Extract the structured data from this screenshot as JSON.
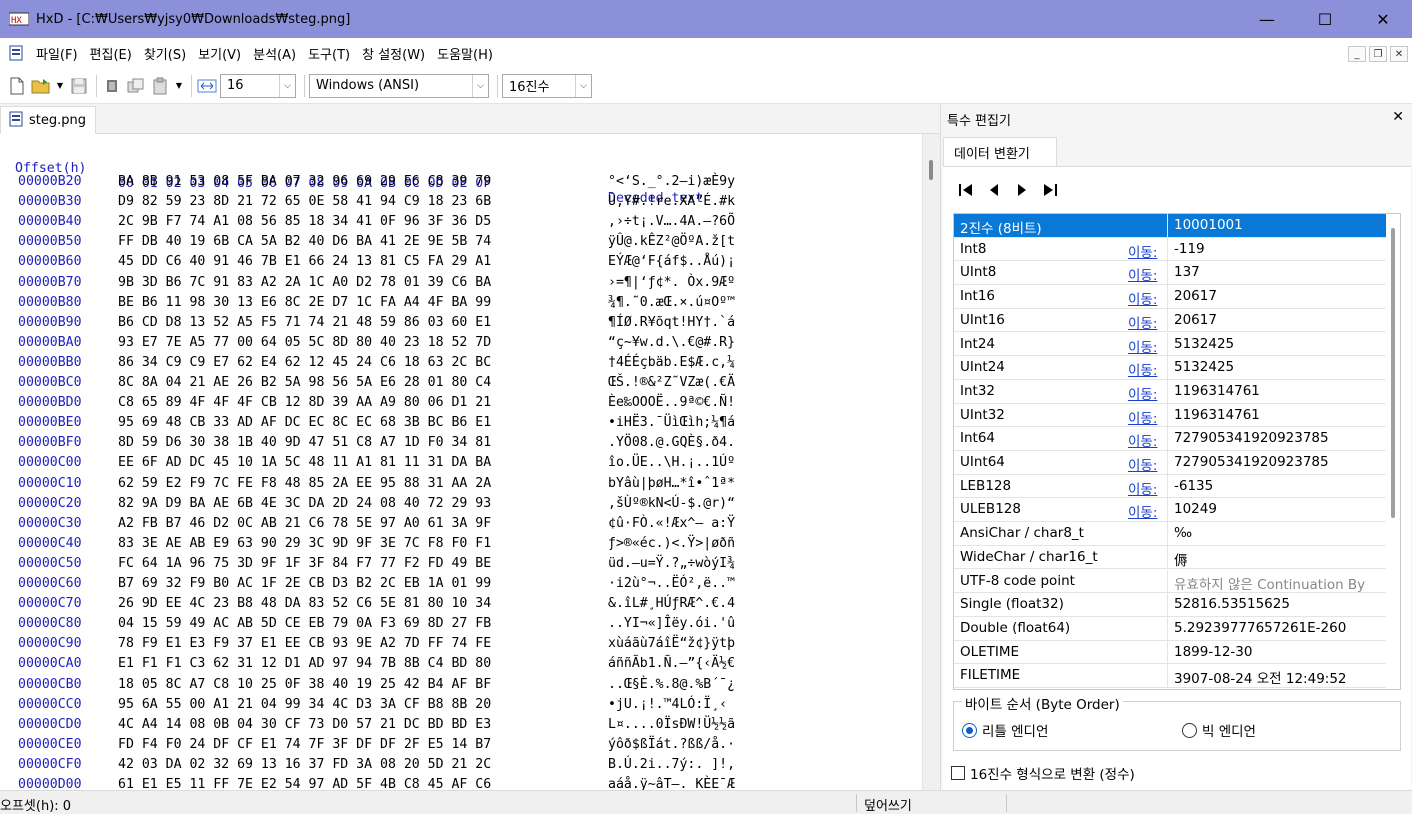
{
  "window": {
    "title": "HxD - [C:₩Users₩yjsy0₩Downloads₩steg.png]",
    "minimize": "—",
    "maximize": "☐",
    "close": "✕"
  },
  "menu": {
    "items": [
      "파일(F)",
      "편집(E)",
      "찾기(S)",
      "보기(V)",
      "분석(A)",
      "도구(T)",
      "창 설정(W)",
      "도움말(H)"
    ]
  },
  "mdi": {
    "minimize": "_",
    "restore": "❐",
    "close": "✕"
  },
  "toolbar": {
    "bytes_per_row": "16",
    "charset": "Windows (ANSI)",
    "offset_base": "16진수"
  },
  "document": {
    "tab_label": "steg.png"
  },
  "hex": {
    "header_offset": "Offset(h)",
    "header_bytes": "00 01 02 03 04 05 06 07 08 09 0A 0B 0C 0D 0E 0F",
    "header_text": "Decoded text",
    "rows": [
      {
        "off": "00000B20",
        "bytes": "BA 8B 91 53 08 5F BA 07 32 96 69 29 E6 C8 39 79",
        "text": "°<‘S._°.2–i)æÈ9y"
      },
      {
        "off": "00000B30",
        "bytes": "D9 82 59 23 8D 21 72 65 0E 58 41 94 C9 18 23 6B",
        "text": "Ù‚Y#.!re.XA”É.#k"
      },
      {
        "off": "00000B40",
        "bytes": "2C 9B F7 74 A1 08 56 85 18 34 41 0F 96 3F 36 D5",
        "text": ",›÷t¡.V….4A.–?6Õ"
      },
      {
        "off": "00000B50",
        "bytes": "FF DB 40 19 6B CA 5A B2 40 D6 BA 41 2E 9E 5B 74",
        "text": "ÿÛ@.kÊZ²@ÖºA.ž[t"
      },
      {
        "off": "00000B60",
        "bytes": "45 DD C6 40 91 46 7B E1 66 24 13 81 C5 FA 29 A1",
        "text": "EÝÆ@‘F{áf$..Åú)¡"
      },
      {
        "off": "00000B70",
        "bytes": "9B 3D B6 7C 91 83 A2 2A 1C A0 D2 78 01 39 C6 BA",
        "text": "›=¶|‘ƒ¢*. Òx.9Æº"
      },
      {
        "off": "00000B80",
        "bytes": "BE B6 11 98 30 13 E6 8C 2E D7 1C FA A4 4F BA 99",
        "text": "¾¶.˜0.æŒ.×.ú¤Oº™"
      },
      {
        "off": "00000B90",
        "bytes": "B6 CD D8 13 52 A5 F5 71 74 21 48 59 86 03 60 E1",
        "text": "¶ÍØ.R¥õqt!HY†.`á"
      },
      {
        "off": "00000BA0",
        "bytes": "93 E7 7E A5 77 00 64 05 5C 8D 80 40 23 18 52 7D",
        "text": "“ç~¥w.d.\\.€@#.R}"
      },
      {
        "off": "00000BB0",
        "bytes": "86 34 C9 C9 E7 62 E4 62 12 45 24 C6 18 63 2C BC",
        "text": "†4ÉÉçbäb.E$Æ.c,¼"
      },
      {
        "off": "00000BC0",
        "bytes": "8C 8A 04 21 AE 26 B2 5A 98 56 5A E6 28 01 80 C4",
        "text": "ŒŠ.!®&²Z˜VZæ(.€Ä"
      },
      {
        "off": "00000BD0",
        "bytes": "C8 65 89 4F 4F 4F CB 12 8D 39 AA A9 80 06 D1 21",
        "text": "Èe‰OOOË..9ª©€.Ñ!"
      },
      {
        "off": "00000BE0",
        "bytes": "95 69 48 CB 33 AD AF DC EC 8C EC 68 3B BC B6 E1",
        "text": "•iHË3.¯ÜìŒìh;¼¶á"
      },
      {
        "off": "00000BF0",
        "bytes": "8D 59 D6 30 38 1B 40 9D 47 51 C8 A7 1D F0 34 81",
        "text": ".YÖ08.@.GQÈ§.ð4."
      },
      {
        "off": "00000C00",
        "bytes": "EE 6F AD DC 45 10 1A 5C 48 11 A1 81 11 31 DA BA",
        "text": "îo.ÜE..\\H.¡..1Úº"
      },
      {
        "off": "00000C10",
        "bytes": "62 59 E2 F9 7C FE F8 48 85 2A EE 95 88 31 AA 2A",
        "text": "bYâù|þøH…*î•ˆ1ª*"
      },
      {
        "off": "00000C20",
        "bytes": "82 9A D9 BA AE 6B 4E 3C DA 2D 24 08 40 72 29 93",
        "text": "‚šÙº®kN<Ú-$.@r)“"
      },
      {
        "off": "00000C30",
        "bytes": "A2 FB B7 46 D2 0C AB 21 C6 78 5E 97 A0 61 3A 9F",
        "text": "¢û·FÒ.«!Æx^— a:Ÿ"
      },
      {
        "off": "00000C40",
        "bytes": "83 3E AE AB E9 63 90 29 3C 9D 9F 3E 7C F8 F0 F1",
        "text": "ƒ>®«éc.)<.Ÿ>|øðñ"
      },
      {
        "off": "00000C50",
        "bytes": "FC 64 1A 96 75 3D 9F 1F 3F 84 F7 77 F2 FD 49 BE",
        "text": "üd.–u=Ÿ.?„÷wòýI¾"
      },
      {
        "off": "00000C60",
        "bytes": "B7 69 32 F9 B0 AC 1F 2E CB D3 B2 2C EB 1A 01 99",
        "text": "·i2ù°¬..ËÓ²,ë..™"
      },
      {
        "off": "00000C70",
        "bytes": "26 9D EE 4C 23 B8 48 DA 83 52 C6 5E 81 80 10 34",
        "text": "&.îL#¸HÚƒRÆ^.€.4"
      },
      {
        "off": "00000C80",
        "bytes": "04 15 59 49 AC AB 5D CE EB 79 0A F3 69 8D 27 FB",
        "text": "..YI¬«]Îëy.ói.'û"
      },
      {
        "off": "00000C90",
        "bytes": "78 F9 E1 E3 F9 37 E1 EE CB 93 9E A2 7D FF 74 FE",
        "text": "xùáãù7áîË“ž¢}ÿtþ"
      },
      {
        "off": "00000CA0",
        "bytes": "E1 F1 F1 C3 62 31 12 D1 AD 97 94 7B 8B C4 BD 80",
        "text": "áññÃb1.Ñ.—”{‹Ä½€"
      },
      {
        "off": "00000CB0",
        "bytes": "18 05 8C A7 C8 10 25 0F 38 40 19 25 42 B4 AF BF",
        "text": "..Œ§È.%.8@.%B´¯¿"
      },
      {
        "off": "00000CC0",
        "bytes": "95 6A 55 00 A1 21 04 99 34 4C D3 3A CF B8 8B 20",
        "text": "•jU.¡!.™4LÓ:Ï¸‹ "
      },
      {
        "off": "00000CD0",
        "bytes": "4C A4 14 08 0B 04 30 CF 73 D0 57 21 DC BD BD E3",
        "text": "L¤....0ÏsÐW!Ü½½ã"
      },
      {
        "off": "00000CE0",
        "bytes": "FD F4 F0 24 DF CF E1 74 7F 3F DF DF 2F E5 14 B7",
        "text": "ýôð$ßÏát.?ßß/å.·"
      },
      {
        "off": "00000CF0",
        "bytes": "42 03 DA 02 32 69 13 16 37 FD 3A 08 20 5D 21 2C",
        "text": "B.Ú.2i..7ý:. ]!,"
      },
      {
        "off": "00000D00",
        "bytes": "61 E1 E5 11 FF 7E E2 54 97 AD 5F 4B C8 45 AF C6",
        "text": "aáå.ÿ~âT—._KÈE¯Æ"
      }
    ]
  },
  "panel": {
    "title": "특수 편집기",
    "close": "✕",
    "tab": "데이터 변환기",
    "link_label": "이동:",
    "rows": [
      {
        "name": "2진수 (8비트)",
        "link": false,
        "value": "10001001",
        "selected": true
      },
      {
        "name": "Int8",
        "link": true,
        "value": "-119"
      },
      {
        "name": "UInt8",
        "link": true,
        "value": "137"
      },
      {
        "name": "Int16",
        "link": true,
        "value": "20617"
      },
      {
        "name": "UInt16",
        "link": true,
        "value": "20617"
      },
      {
        "name": "Int24",
        "link": true,
        "value": "5132425"
      },
      {
        "name": "UInt24",
        "link": true,
        "value": "5132425"
      },
      {
        "name": "Int32",
        "link": true,
        "value": "1196314761"
      },
      {
        "name": "UInt32",
        "link": true,
        "value": "1196314761"
      },
      {
        "name": "Int64",
        "link": true,
        "value": "727905341920923785"
      },
      {
        "name": "UInt64",
        "link": true,
        "value": "727905341920923785"
      },
      {
        "name": "LEB128",
        "link": true,
        "value": "-6135"
      },
      {
        "name": "ULEB128",
        "link": true,
        "value": "10249"
      },
      {
        "name": "AnsiChar / char8_t",
        "link": false,
        "value": "‰"
      },
      {
        "name": "WideChar / char16_t",
        "link": false,
        "value": "傉"
      },
      {
        "name": "UTF-8 code point",
        "link": false,
        "value": "유효하지 않은 Continuation By",
        "gray": true
      },
      {
        "name": "Single (float32)",
        "link": false,
        "value": "52816.53515625"
      },
      {
        "name": "Double (float64)",
        "link": false,
        "value": "5.29239777657261E-260"
      },
      {
        "name": "OLETIME",
        "link": false,
        "value": "1899-12-30"
      },
      {
        "name": "FILETIME",
        "link": false,
        "value": "3907-08-24 오전 12:49:52"
      }
    ],
    "byte_order": {
      "legend": "바이트 순서 (Byte Order)",
      "little": "리틀 엔디언",
      "big": "빅 엔디언",
      "selected": "little"
    },
    "hex_checkbox": "16진수 형식으로 변환 (정수)"
  },
  "status": {
    "offset": "오프셋(h): 0",
    "mode": "덮어쓰기"
  }
}
